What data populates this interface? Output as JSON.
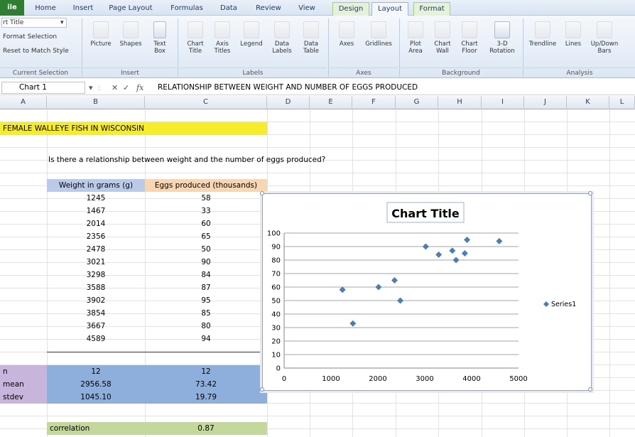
{
  "ribbon_tabs": [
    {
      "label": "ile",
      "x": 0,
      "w": 34,
      "style": "file"
    },
    {
      "label": "Home",
      "x": 44,
      "w": 40
    },
    {
      "label": "Insert",
      "x": 95,
      "w": 44
    },
    {
      "label": "Page Layout",
      "x": 148,
      "w": 72
    },
    {
      "label": "Formulas",
      "x": 236,
      "w": 54
    },
    {
      "label": "Data",
      "x": 305,
      "w": 34
    },
    {
      "label": "Review",
      "x": 356,
      "w": 44
    },
    {
      "label": "View",
      "x": 415,
      "w": 34
    },
    {
      "label": "Design",
      "x": 468,
      "w": 52,
      "style": "ctx"
    },
    {
      "label": "Layout",
      "x": 523,
      "w": 52,
      "style": "active"
    },
    {
      "label": "Format",
      "x": 582,
      "w": 52,
      "style": "ctx"
    }
  ],
  "ribbon": {
    "current_selection": {
      "dropdown_value": "rt Title",
      "format_selection": "Format Selection",
      "reset": "Reset to Match Style",
      "group": "Current Selection"
    },
    "insert": {
      "picture": "Picture",
      "shapes": "Shapes",
      "textbox": "Text\nBox",
      "group": "Insert"
    },
    "labels": {
      "chart_title": "Chart\nTitle",
      "axis_titles": "Axis\nTitles",
      "legend": "Legend",
      "data_labels": "Data\nLabels",
      "data_table": "Data\nTable",
      "group": "Labels"
    },
    "axes": {
      "axes": "Axes",
      "gridlines": "Gridlines",
      "group": "Axes"
    },
    "background": {
      "plot_area": "Plot\nArea",
      "chart_wall": "Chart\nWall",
      "chart_floor": "Chart\nFloor",
      "rotation": "3-D\nRotation",
      "group": "Background"
    },
    "analysis": {
      "trendline": "Trendline",
      "lines": "Lines",
      "updown": "Up/Down\nBars",
      "group": "Analysis"
    }
  },
  "formula_bar": {
    "name_box": "Chart 1",
    "content": "RELATIONSHIP BETWEEN WEIGHT AND NUMBER OF EGGS PRODUCED"
  },
  "columns": [
    "A",
    "B",
    "C",
    "D",
    "E",
    "F",
    "G",
    "H",
    "I",
    "J",
    "K",
    "L"
  ],
  "sheet": {
    "title": "FEMALE WALLEYE FISH IN WISCONSIN",
    "question": "Is there a relationship between weight and the number of eggs produced?",
    "headers": {
      "weight": "Weight in grams (g)",
      "eggs": "Eggs produced (thousands)"
    },
    "rows": [
      {
        "weight": "1245",
        "eggs": "58"
      },
      {
        "weight": "1467",
        "eggs": "33"
      },
      {
        "weight": "2014",
        "eggs": "60"
      },
      {
        "weight": "2356",
        "eggs": "65"
      },
      {
        "weight": "2478",
        "eggs": "50"
      },
      {
        "weight": "3021",
        "eggs": "90"
      },
      {
        "weight": "3298",
        "eggs": "84"
      },
      {
        "weight": "3588",
        "eggs": "87"
      },
      {
        "weight": "3902",
        "eggs": "95"
      },
      {
        "weight": "3854",
        "eggs": "85"
      },
      {
        "weight": "3667",
        "eggs": "80"
      },
      {
        "weight": "4589",
        "eggs": "94"
      }
    ],
    "stats": [
      {
        "label": "n",
        "weight": "12",
        "eggs": "12"
      },
      {
        "label": "mean",
        "weight": "2956.58",
        "eggs": "73.42"
      },
      {
        "label": "stdev",
        "weight": "1045.10",
        "eggs": "19.79"
      }
    ],
    "correlation": {
      "label": "correlation",
      "value": "0.87"
    }
  },
  "chart_data": {
    "type": "scatter",
    "title": "Chart Title",
    "series": [
      {
        "name": "Series1",
        "color": "#4a7ebb",
        "x": [
          1245,
          1467,
          2014,
          2356,
          2478,
          3021,
          3298,
          3588,
          3902,
          3854,
          3667,
          4589
        ],
        "y": [
          58,
          33,
          60,
          65,
          50,
          90,
          84,
          87,
          95,
          85,
          80,
          94
        ]
      }
    ],
    "xlim": [
      0,
      5000
    ],
    "ylim": [
      0,
      100
    ],
    "xticks": [
      "0",
      "1000",
      "2000",
      "3000",
      "4000",
      "5000"
    ],
    "yticks": [
      "0",
      "10",
      "20",
      "30",
      "40",
      "50",
      "60",
      "70",
      "80",
      "90",
      "100"
    ],
    "grid": "horizontal major",
    "legend": "right"
  }
}
